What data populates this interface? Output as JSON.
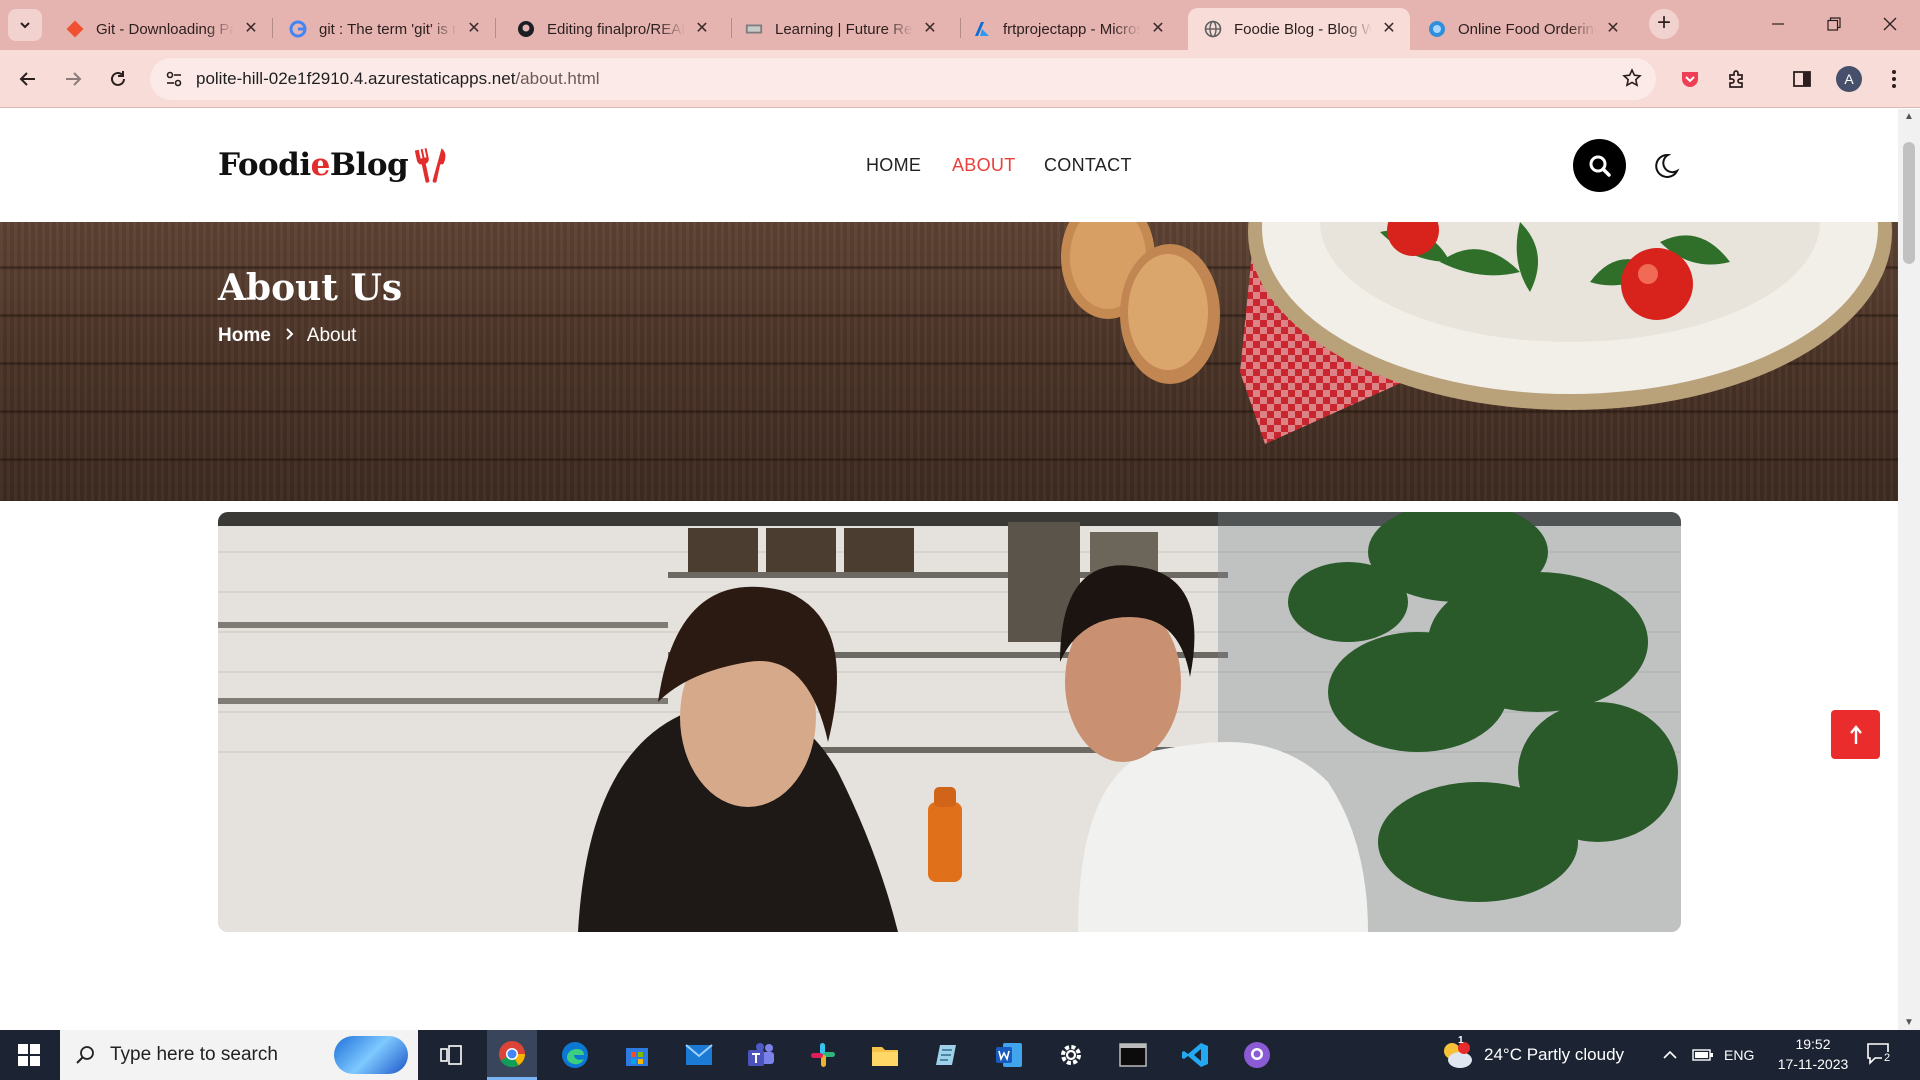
{
  "browser": {
    "tabs": [
      {
        "title": "Git - Downloading Package",
        "favicon": "git-icon",
        "active": false
      },
      {
        "title": "git : The term 'git' is not recognized",
        "favicon": "google-icon",
        "active": false
      },
      {
        "title": "Editing finalpro/README.md",
        "favicon": "github-icon",
        "active": false
      },
      {
        "title": "Learning | Future Ready Talent",
        "favicon": "learning-icon",
        "active": false
      },
      {
        "title": "frtprojectapp - Microsoft Azure",
        "favicon": "azure-icon",
        "active": false
      },
      {
        "title": "Foodie Blog - Blog Website",
        "favicon": "globe-icon",
        "active": true
      },
      {
        "title": "Online Food Ordering",
        "favicon": "edge-globe-icon",
        "active": false
      }
    ],
    "url_host": "polite-hill-02e1f2910.4.azurestaticapps.net",
    "url_path": "/about.html",
    "profile_initial": "A"
  },
  "site": {
    "logo_part1": "Foodi",
    "logo_part2": "e",
    "logo_part3": " Blog",
    "nav": {
      "home": "HOME",
      "about": "ABOUT",
      "contact": "CONTACT"
    },
    "hero_title": "About Us",
    "breadcrumb_home": "Home",
    "breadcrumb_current": "About",
    "accent_color": "#e8403a"
  },
  "taskbar": {
    "search_placeholder": "Type here to search",
    "weather": "24°C  Partly cloudy",
    "weather_badge": "1",
    "language": "ENG",
    "time": "19:52",
    "date": "17-11-2023",
    "notification_count": "2"
  }
}
